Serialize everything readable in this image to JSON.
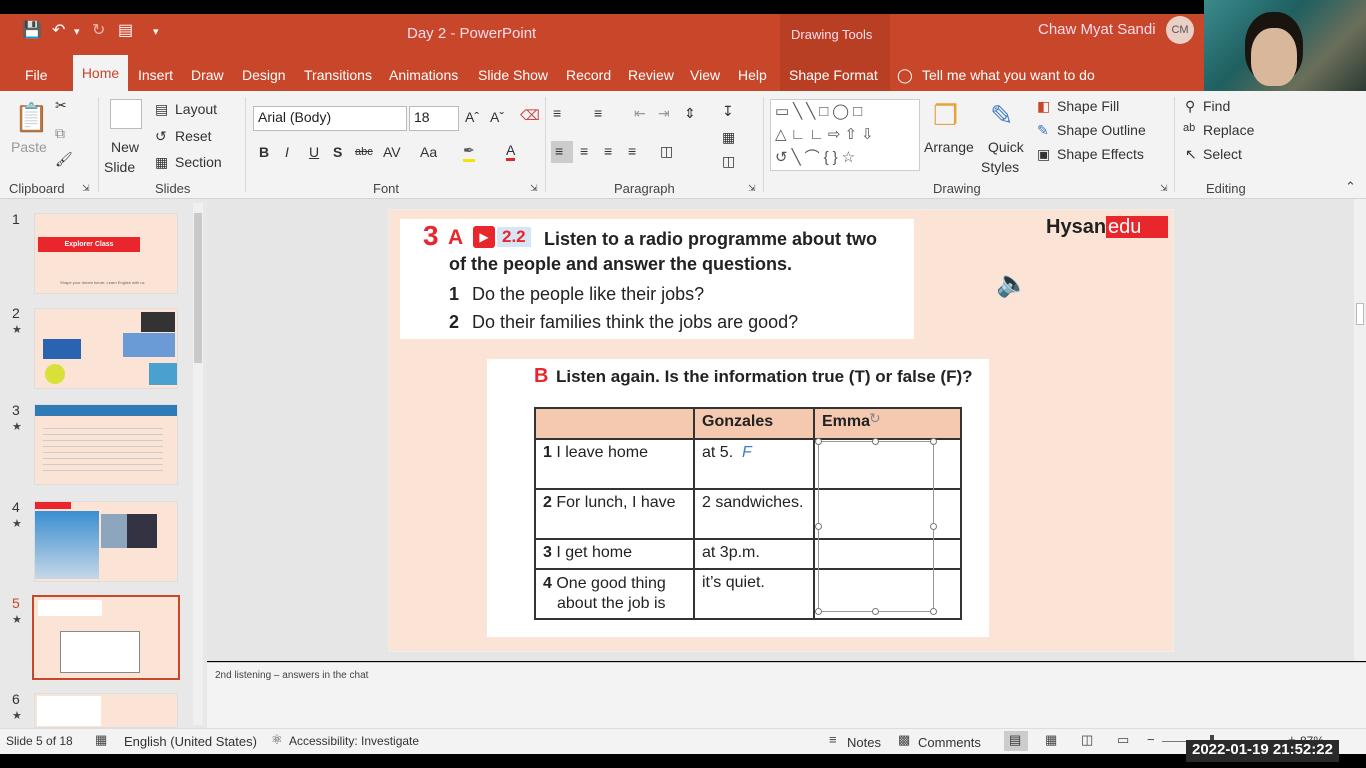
{
  "window": {
    "doc_title": "Day 2  -  PowerPoint",
    "contextual_group": "Drawing Tools",
    "user_name": "Chaw Myat Sandi",
    "user_initials": "CM"
  },
  "tabs": [
    "File",
    "Home",
    "Insert",
    "Draw",
    "Design",
    "Transitions",
    "Animations",
    "Slide Show",
    "Record",
    "Review",
    "View",
    "Help",
    "Shape Format"
  ],
  "tell_me": "Tell me what you want to do",
  "ribbon": {
    "clipboard": {
      "paste": "Paste",
      "group": "Clipboard"
    },
    "slides": {
      "new_slide_1": "New",
      "new_slide_2": "Slide",
      "layout": "Layout",
      "reset": "Reset",
      "section": "Section",
      "group": "Slides"
    },
    "font": {
      "family": "Arial (Body)",
      "size": "18",
      "group": "Font",
      "bold": "B",
      "italic": "I",
      "underline": "U",
      "shadow": "S",
      "strike": "abc",
      "spacing": "AV",
      "case": "Aa",
      "grow": "Aˆ",
      "shrink": "Aˇ",
      "color_a": "A"
    },
    "paragraph": {
      "group": "Paragraph"
    },
    "drawing": {
      "arrange": "Arrange",
      "quick_styles_1": "Quick",
      "quick_styles_2": "Styles",
      "shape_fill": "Shape Fill",
      "shape_outline": "Shape Outline",
      "shape_effects": "Shape Effects",
      "group": "Drawing"
    },
    "editing": {
      "find": "Find",
      "replace": "Replace",
      "select": "Select",
      "group": "Editing"
    }
  },
  "thumbnails": [
    {
      "num": "1",
      "star": "",
      "title": "Explorer Class",
      "caption": "Shape your dream future: Learn English with us"
    },
    {
      "num": "2",
      "star": "★",
      "title": "",
      "caption": ""
    },
    {
      "num": "3",
      "star": "★",
      "title": "",
      "caption": ""
    },
    {
      "num": "4",
      "star": "★",
      "title": "",
      "caption": ""
    },
    {
      "num": "5",
      "star": "★",
      "title": "",
      "caption": ""
    },
    {
      "num": "6",
      "star": "★",
      "title": "",
      "caption": ""
    }
  ],
  "slide": {
    "brand_a": "Hysan",
    "brand_b": "edu",
    "section_num": "3",
    "part_a": "A",
    "track": "2.2",
    "instruction_a_1": "Listen to a radio programme about two",
    "instruction_a_2": "of the people and answer the questions.",
    "q1_num": "1",
    "q1": "Do the people like their jobs?",
    "q2_num": "2",
    "q2": "Do their families think the jobs are good?",
    "part_b": "B",
    "instruction_b": "Listen again. Is the information true (T) or false (F)?",
    "table": {
      "headers": [
        "",
        "Gonzales",
        "Emma"
      ],
      "rows": [
        {
          "num": "1",
          "label": "I leave home",
          "gonzales": "at 5.",
          "mark": "F",
          "emma": ""
        },
        {
          "num": "2",
          "label": "For lunch, I have",
          "gonzales": "2 sandwiches.",
          "emma": ""
        },
        {
          "num": "3",
          "label": "I get home",
          "gonzales": "at 3p.m.",
          "emma": ""
        },
        {
          "num": "4",
          "label": "One good thing",
          "label2": "about the job is",
          "gonzales": "it’s quiet.",
          "emma": ""
        }
      ]
    }
  },
  "notes": "2nd listening – answers in the chat",
  "status": {
    "slide": "Slide 5 of 18",
    "language": "English (United States)",
    "accessibility": "Accessibility: Investigate",
    "notes_btn": "Notes",
    "comments_btn": "Comments",
    "zoom": "87%"
  },
  "timestamp": "2022-01-19  21:52:22"
}
